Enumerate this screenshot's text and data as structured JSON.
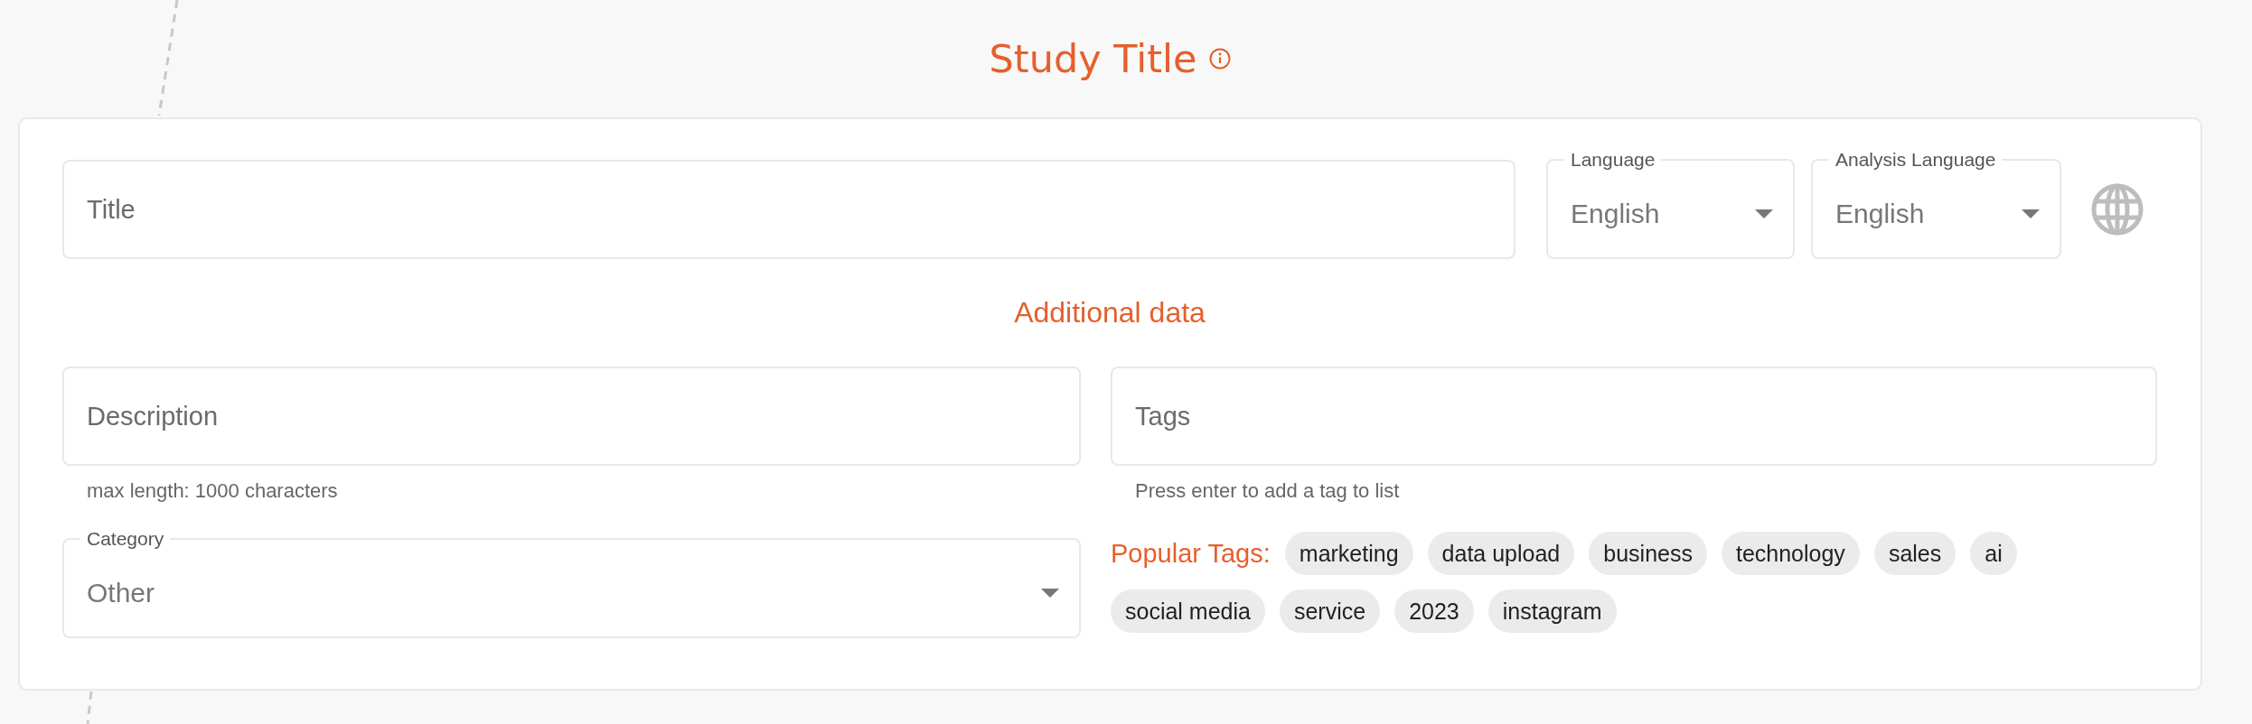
{
  "header": {
    "title": "Study Title"
  },
  "form": {
    "title_field": {
      "placeholder": "Title"
    },
    "language": {
      "label": "Language",
      "value": "English"
    },
    "analysis_language": {
      "label": "Analysis Language",
      "value": "English"
    },
    "section_title": "Additional data",
    "description": {
      "placeholder": "Description",
      "helper": "max length: 1000 characters"
    },
    "category": {
      "label": "Category",
      "value": "Other"
    },
    "tags": {
      "placeholder": "Tags",
      "helper": "Press enter to add a tag to list"
    },
    "popular_tags": {
      "label": "Popular Tags:",
      "items": [
        "marketing",
        "data upload",
        "business",
        "technology",
        "sales",
        "ai",
        "social media",
        "service",
        "2023",
        "instagram"
      ]
    }
  }
}
